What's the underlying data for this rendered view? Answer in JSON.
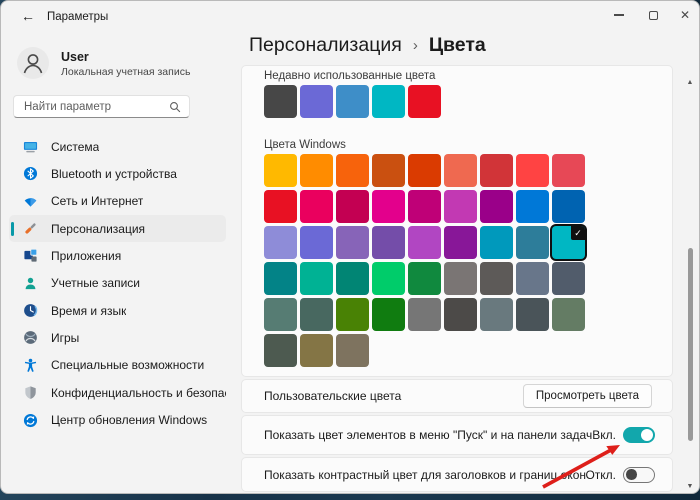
{
  "window": {
    "title": "Параметры"
  },
  "sidebar": {
    "user": {
      "name": "User",
      "subtitle": "Локальная учетная запись"
    },
    "search_placeholder": "Найти параметр",
    "selection_pill_color": "#0899A8",
    "items": [
      {
        "label": "Система",
        "icon": "system-icon",
        "selected": false
      },
      {
        "label": "Bluetooth и устройства",
        "icon": "bluetooth-icon",
        "selected": false
      },
      {
        "label": "Сеть и Интернет",
        "icon": "network-icon",
        "selected": false
      },
      {
        "label": "Персонализация",
        "icon": "personalization-icon",
        "selected": true
      },
      {
        "label": "Приложения",
        "icon": "apps-icon",
        "selected": false
      },
      {
        "label": "Учетные записи",
        "icon": "accounts-icon",
        "selected": false
      },
      {
        "label": "Время и язык",
        "icon": "time-language-icon",
        "selected": false
      },
      {
        "label": "Игры",
        "icon": "gaming-icon",
        "selected": false
      },
      {
        "label": "Специальные возможности",
        "icon": "accessibility-icon",
        "selected": false
      },
      {
        "label": "Конфиденциальность и безопас",
        "icon": "privacy-icon",
        "selected": false
      },
      {
        "label": "Центр обновления Windows",
        "icon": "windows-update-icon",
        "selected": false
      }
    ]
  },
  "header": {
    "breadcrumb_parent": "Персонализация",
    "breadcrumb_current": "Цвета"
  },
  "content": {
    "accent_color": "#00B7C3",
    "toggle_on_color": "#12A7AC",
    "recent": {
      "label": "Недавно использованные цвета",
      "colors": [
        "#474747",
        "#6B69D6",
        "#3E8EC8",
        "#00B7C3",
        "#E81123"
      ]
    },
    "windows_colors": {
      "label": "Цвета Windows",
      "selected_index": 26,
      "colors": [
        "#FFB900",
        "#FF8C00",
        "#F7630C",
        "#CA5010",
        "#DA3B01",
        "#EF6950",
        "#D13438",
        "#FF4343",
        "#E74856",
        "#E81123",
        "#EA005E",
        "#C30052",
        "#E3008C",
        "#BF0077",
        "#C239B3",
        "#9A0089",
        "#0078D7",
        "#0063B1",
        "#8E8CD8",
        "#6B69D6",
        "#8764B8",
        "#744DA9",
        "#B146C2",
        "#881798",
        "#0099BC",
        "#2D7D9A",
        "#00B7C3",
        "#038387",
        "#00B294",
        "#018574",
        "#00CC6A",
        "#10893E",
        "#7A7574",
        "#5D5A58",
        "#68768A",
        "#515C6B",
        "#567C73",
        "#486860",
        "#498205",
        "#107C10",
        "#767676",
        "#4C4A48",
        "#69797E",
        "#4A5459",
        "#647C64",
        "#4D5A50",
        "#847545",
        "#7E735F"
      ]
    },
    "custom": {
      "label": "Пользовательские цвета",
      "button_label": "Просмотреть цвета"
    },
    "toggles": [
      {
        "label": "Показать цвет элементов в меню \"Пуск\" и на панели задач",
        "state_label": "Вкл.",
        "on": true
      },
      {
        "label": "Показать контрастный цвет для заголовков и границ окон",
        "state_label": "Откл.",
        "on": false
      }
    ]
  },
  "annotation": {
    "type": "red-arrow",
    "color": "#DE1F1A"
  }
}
